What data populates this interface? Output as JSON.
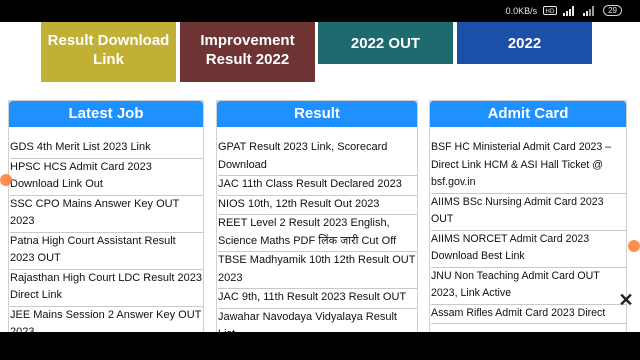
{
  "status_bar": {
    "network_speed": "0.0KB/s",
    "battery": "29"
  },
  "top_tiles": [
    {
      "lines": [
        "Result Download",
        "Link"
      ],
      "color": "#c1b033"
    },
    {
      "lines": [
        "Improvement",
        "Result 2022"
      ],
      "color": "#6e3434"
    },
    {
      "lines": [
        "2022 OUT"
      ],
      "color": "#1e6b6f"
    },
    {
      "lines": [
        "2022"
      ],
      "color": "#1c4fa8"
    }
  ],
  "columns": [
    {
      "title": "Latest Job",
      "items": [
        "GDS 4th Merit List 2023 Link",
        "HPSC HCS Admit Card 2023 Download Link Out",
        "SSC CPO Mains Answer Key OUT 2023",
        "Patna High Court Assistant Result 2023 OUT",
        "Rajasthan High Court LDC Result 2023 Direct Link",
        "JEE Mains Session 2 Answer Key OUT 2023"
      ]
    },
    {
      "title": "Result",
      "items": [
        "GPAT Result 2023 Link, Scorecard Download",
        "JAC 11th Class Result Declared 2023",
        "NIOS 10th, 12th Result Out 2023",
        "REET Level 2 Result 2023 English, Science Maths PDF लिंक जारी Cut Off",
        "TBSE Madhyamik 10th 12th Result OUT 2023",
        "JAC 9th, 11th Result 2023 Result OUT",
        "Jawahar Navodaya Vidyalaya Result List"
      ]
    },
    {
      "title": "Admit Card",
      "items": [
        "BSF HC Ministerial Admit Card 2023 – Direct Link HCM & ASI Hall Ticket @ bsf.gov.in",
        "AIIMS BSc Nursing Admit Card 2023 OUT",
        "AIIMS NORCET Admit Card 2023 Download Best Link",
        "JNU Non Teaching Admit Card OUT 2023, Link Active",
        "Assam Rifles Admit Card 2023 Direct"
      ]
    }
  ],
  "close_label": "✕"
}
